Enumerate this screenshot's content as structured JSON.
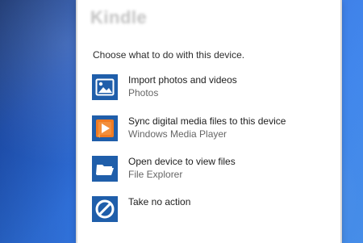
{
  "dialog": {
    "device_name": "Kindle",
    "prompt": "Choose what to do with this device.",
    "options": [
      {
        "title": "Import photos and videos",
        "subtitle": "Photos",
        "icon": "photos-icon"
      },
      {
        "title": "Sync digital media files to this device",
        "subtitle": "Windows Media Player",
        "icon": "windows-media-player-icon"
      },
      {
        "title": "Open device to view files",
        "subtitle": "File Explorer",
        "icon": "folder-open-icon"
      },
      {
        "title": "Take no action",
        "subtitle": "",
        "icon": "no-action-icon"
      }
    ]
  },
  "colors": {
    "wallpaper": "#2f72e0",
    "dialog_background": "#ffffff",
    "tile_blue": "#1f5eaa",
    "media_player_orange": "#f07b22"
  }
}
